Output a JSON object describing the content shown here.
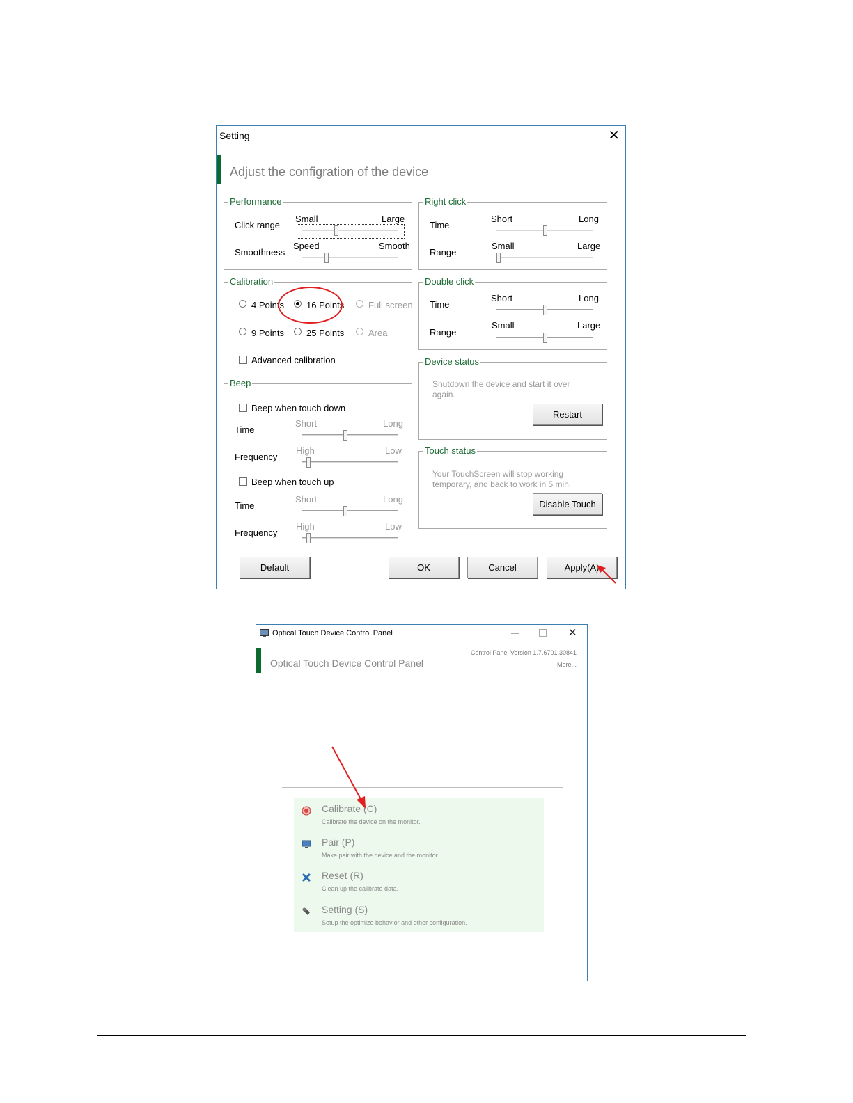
{
  "settings": {
    "title": "Setting",
    "subtitle": "Adjust the configration of the device",
    "performance": {
      "title": "Performance",
      "click_range": {
        "label": "Click range",
        "min_label": "Small",
        "max_label": "Large",
        "value": 0.35
      },
      "smoothness": {
        "label": "Smoothness",
        "min_label": "Speed",
        "max_label": "Smooth",
        "value": 0.25
      }
    },
    "calibration": {
      "title": "Calibration",
      "options": [
        "4 Points",
        "16 Points",
        "Full screen",
        "9 Points",
        "25 Points",
        "Area"
      ],
      "selected": "16 Points",
      "advanced_label": "Advanced calibration"
    },
    "beep": {
      "title": "Beep",
      "down_label": "Beep when touch down",
      "up_label": "Beep when touch up",
      "time_label": "Time",
      "frequency_label": "Frequency",
      "short": "Short",
      "long": "Long",
      "high": "High",
      "low": "Low",
      "down_time_value": 0.45,
      "down_frequency_value": 0.05,
      "up_time_value": 0.45,
      "up_frequency_value": 0.05
    },
    "right_click": {
      "title": "Right click",
      "time": {
        "label": "Time",
        "min_label": "Short",
        "max_label": "Long",
        "value": 0.5
      },
      "range": {
        "label": "Range",
        "min_label": "Small",
        "max_label": "Large",
        "value": 0.0
      }
    },
    "double_click": {
      "title": "Double click",
      "time": {
        "label": "Time",
        "min_label": "Short",
        "max_label": "Long",
        "value": 0.5
      },
      "range": {
        "label": "Range",
        "min_label": "Small",
        "max_label": "Large",
        "value": 0.5
      }
    },
    "device_status": {
      "title": "Device status",
      "text1": "Shutdown the device and start it over",
      "text2": "again.",
      "button": "Restart"
    },
    "touch_status": {
      "title": "Touch status",
      "text1": "Your TouchScreen will stop working",
      "text2": "temporary, and back to work in 5 min.",
      "button": "Disable Touch"
    },
    "buttons": {
      "default": "Default",
      "ok": "OK",
      "cancel": "Cancel",
      "apply": "Apply(A)"
    }
  },
  "control_panel": {
    "title": "Optical Touch Device Control Panel",
    "heading": "Optical Touch Device Control Panel",
    "version": "Control Panel Version 1.7.6701.30841",
    "more": "More...",
    "items": [
      {
        "name": "Calibrate (C)",
        "desc": "Calibrate the device on the monitor.",
        "icon": "target-icon"
      },
      {
        "name": "Pair (P)",
        "desc": "Make pair with the device and the monitor.",
        "icon": "monitor-icon"
      },
      {
        "name": "Reset (R)",
        "desc": "Clean up the calibrate data.",
        "icon": "reset-icon"
      },
      {
        "name": "Setting (S)",
        "desc": "Setup the optimize behavior and other configuration.",
        "icon": "wrench-icon"
      }
    ]
  },
  "colors": {
    "accent_green": "#0b6a2d",
    "group_title": "#1e6b36",
    "annotation_red": "#e02020",
    "item_bg": "#edf9ec"
  }
}
